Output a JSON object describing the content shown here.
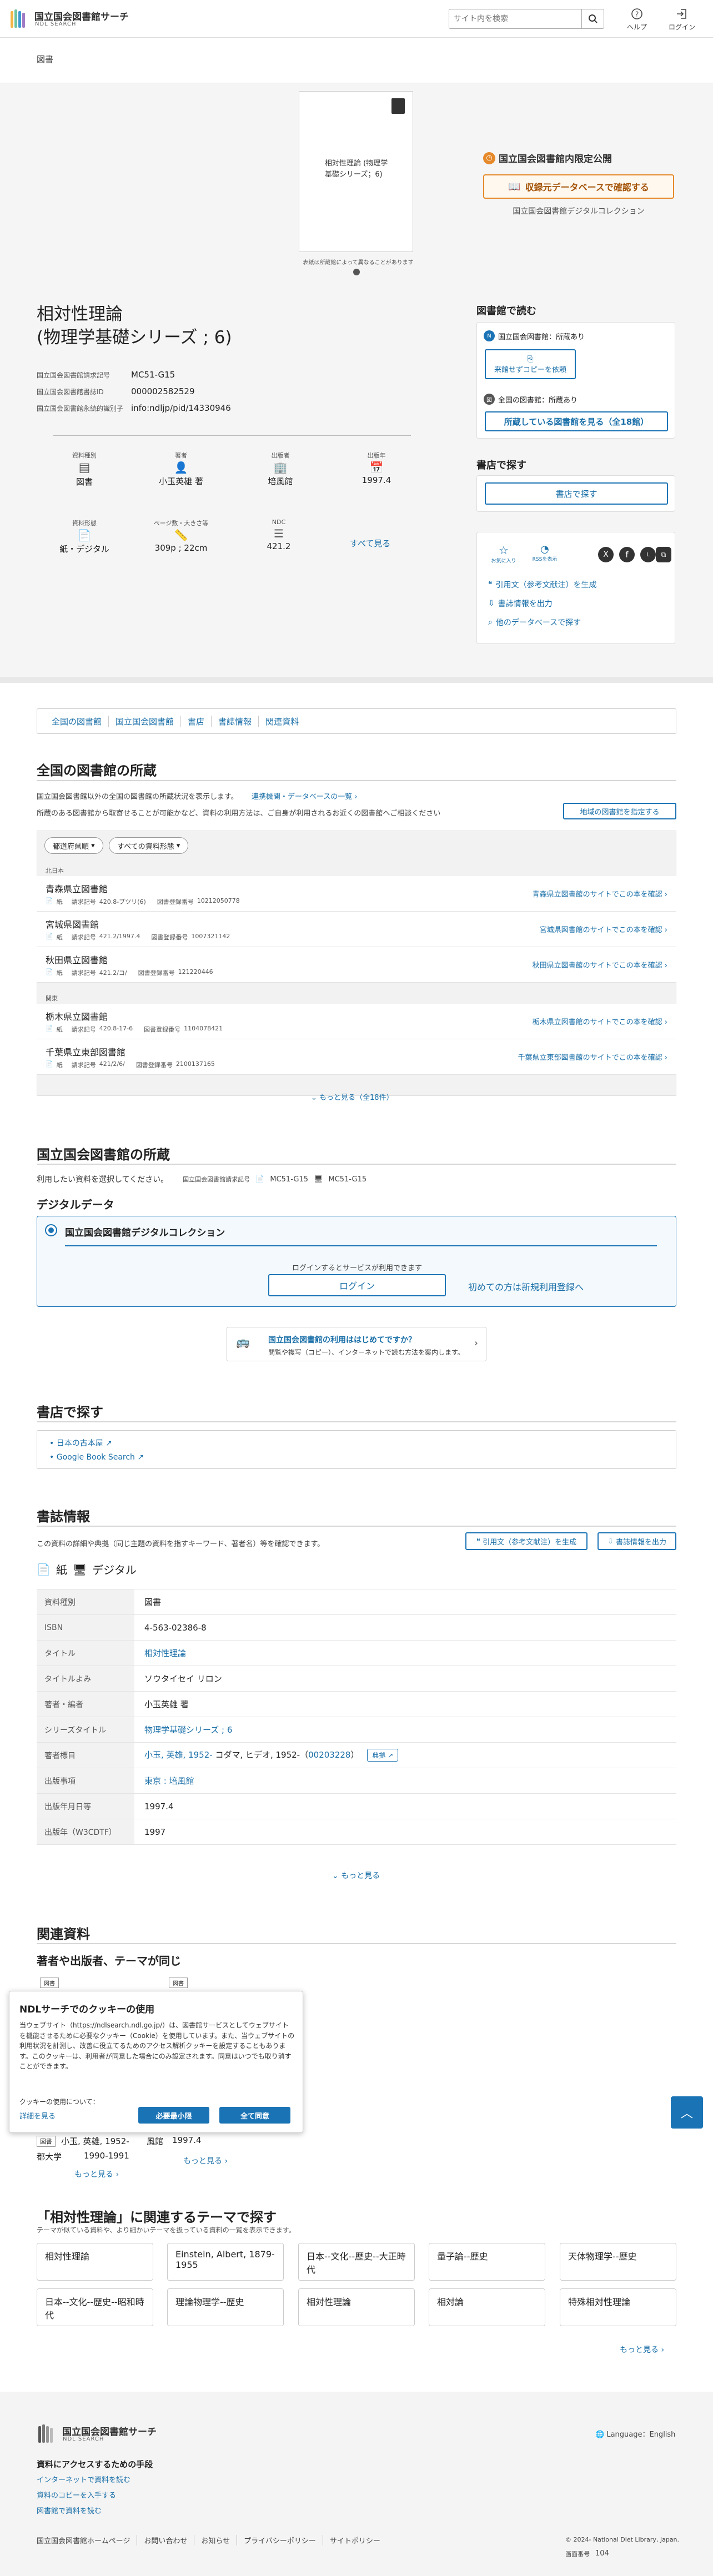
{
  "header": {
    "logo_jp": "国立国会図書館サーチ",
    "logo_en": "NDL SEARCH",
    "search_placeholder": "サイト内を検索",
    "help": "ヘルプ",
    "login": "ログイン"
  },
  "breadcrumb": "図書",
  "cover": {
    "title_text": "相対性理論 (物理学基礎シリーズ；6)",
    "note": "表紙は所蔵館によって異なることがあります"
  },
  "ndl_only": {
    "label": "国立国会図書館内限定公開",
    "button": "収録元データベースで確認する",
    "source": "国立国会図書館デジタルコレクション"
  },
  "book": {
    "title_line1": "相対性理論",
    "title_line2": "(物理学基礎シリーズ ; 6)",
    "meta": [
      {
        "key": "国立国会図書館請求記号",
        "value": "MC51-G15"
      },
      {
        "key": "国立国会図書館書誌ID",
        "value": "000002582529"
      },
      {
        "key": "国立国会図書館永続的識別子",
        "value": "info:ndljp/pid/14330946"
      }
    ],
    "facets_row1": [
      {
        "label": "資料種別",
        "value": "図書"
      },
      {
        "label": "著者",
        "value": "小玉英雄 著"
      },
      {
        "label": "出版者",
        "value": "培風館"
      },
      {
        "label": "出版年",
        "value": "1997.4"
      }
    ],
    "facets_row2": [
      {
        "label": "資料形態",
        "value": "紙・デジタル"
      },
      {
        "label": "ページ数・大きさ等",
        "value": "309p ; 22cm"
      },
      {
        "label": "NDC",
        "value": "421.2"
      }
    ],
    "see_all": "すべて見る"
  },
  "read_at_library": {
    "heading": "図書館で読む",
    "ndl_label": "国立国会図書館：所蔵あり",
    "copy_button": "来館せずコピーを依頼",
    "all_libs_label": "全国の図書館：所蔵あり",
    "all_libs_button": "所蔵している図書館を見る（全18館）"
  },
  "buy": {
    "heading": "書店で探す",
    "button": "書店で探す"
  },
  "share": {
    "favorite": "お気に入り",
    "rss": "RSSを表示",
    "cite": "引用文（参考文献注）を生成",
    "export": "書誌情報を出力",
    "other_db": "他のデータベースで探す"
  },
  "tabs": [
    "全国の図書館",
    "国立国会図書館",
    "書店",
    "書誌情報",
    "関連資料"
  ],
  "national_libraries": {
    "heading": "全国の図書館の所蔵",
    "desc1": "国立国会図書館以外の全国の図書館の所蔵状況を表示します。",
    "link": "連携機関・データベースの一覧",
    "desc2": "所蔵のある図書館から取寄せることが可能かなど、資料の利用方法は、ご自身が利用されるお近くの図書館へご相談ください",
    "region_button": "地域の図書館を指定する",
    "filter1": "都道府県順",
    "filter2": "すべての資料形態",
    "groups": [
      {
        "region": "北日本",
        "libs": [
          {
            "name": "青森県立図書館",
            "call": "420.8-ブツリ(6)",
            "reg": "10212050778",
            "link": "青森県立図書館のサイトでこの本を確認"
          },
          {
            "name": "宮城県図書館",
            "call": "421.2/1997.4",
            "reg": "1007321142",
            "link": "宮城県図書館のサイトでこの本を確認"
          },
          {
            "name": "秋田県立図書館",
            "call": "421.2/コ/",
            "reg": "121220446",
            "link": "秋田県立図書館のサイトでこの本を確認"
          }
        ]
      },
      {
        "region": "関東",
        "libs": [
          {
            "name": "栃木県立図書館",
            "call": "420.8-17-6",
            "reg": "1104078421",
            "link": "栃木県立図書館のサイトでこの本を確認"
          },
          {
            "name": "千葉県立東部図書館",
            "call": "421/2/6/",
            "reg": "2100137165",
            "link": "千葉県立東部図書館のサイトでこの本を確認"
          }
        ]
      }
    ],
    "paper": "紙",
    "call_label": "請求記号",
    "reg_label": "図書登録番号",
    "more": "もっと見る（全18件）"
  },
  "ndl_holdings": {
    "heading": "国立国会図書館の所蔵",
    "desc": "利用したい資料を選択してください。",
    "call_key": "国立国会図書館請求記号",
    "call1": "MC51-G15",
    "call2": "MC51-G15",
    "digital_heading": "デジタルデータ",
    "collection": "国立国会図書館デジタルコレクション",
    "login_note": "ログインするとサービスが利用できます",
    "login_button": "ログイン",
    "register": "初めての方は新規利用登録へ"
  },
  "first_time": {
    "title": "国立国会図書館の利用ははじめてですか？",
    "desc": "閲覧や複写（コピー）、インターネットで読む方法を案内します。"
  },
  "stores": {
    "heading": "書店で探す",
    "links": [
      "日本の古本屋",
      "Google Book Search"
    ]
  },
  "bib": {
    "heading": "書誌情報",
    "desc": "この資料の詳細や典拠（同じ主題の資料を指すキーワード、著者名）等を確認できます。",
    "cite_button": "引用文（参考文献注）を生成",
    "export_button": "書誌情報を出力",
    "formats": [
      "紙",
      "デジタル"
    ],
    "rows": [
      {
        "k": "資料種別",
        "v": "図書"
      },
      {
        "k": "ISBN",
        "v": "4-563-02386-8"
      },
      {
        "k": "タイトル",
        "v": "相対性理論"
      },
      {
        "k": "タイトルよみ",
        "v": "ソウタイセイ リロン"
      },
      {
        "k": "著者・編者",
        "v": "小玉英雄 著"
      },
      {
        "k": "シリーズタイトル",
        "v": "物理学基礎シリーズ ; 6"
      },
      {
        "k": "著者標目",
        "v_link": "小玉, 英雄, 1952-",
        "v_plain": " コダマ, ヒデオ, 1952-（",
        "v_id": "00203228",
        "v_end": "）",
        "tenkyo": "典拠"
      },
      {
        "k": "出版事項",
        "v": "東京 : 培風館"
      },
      {
        "k": "出版年月日等",
        "v": "1997.4"
      },
      {
        "k": "出版年（W3CDTF）",
        "v": "1997"
      }
    ],
    "more": "もっと見る"
  },
  "related": {
    "heading": "関連資料",
    "sub": "著者や出版者、テーマが同じ",
    "tag1": "図書",
    "tag2": "図書",
    "item_tag": "図書",
    "item_author": "小玉, 英雄, 1952-",
    "item_pub": "都大学",
    "item_years": "1990-1991",
    "item2_pub": "風館",
    "item2_year": "1997.4",
    "more1": "もっと見る",
    "more2": "もっと見る"
  },
  "cookie": {
    "title": "NDLサーチでのクッキーの使用",
    "body": "当ウェブサイト（https://ndlsearch.ndl.go.jp/）は、図書館サービスとしてウェブサイトを機能させるために必要なクッキー（Cookie）を使用しています。また、当ウェブサイトの利用状況を計測し、改善に役立てるためのアクセス解析クッキーを設定することもあります。このクッキーは、利用者が同意した場合にのみ設定されます。同意はいつでも取り消すことができます。",
    "about": "クッキーの使用について：",
    "details": "詳細を見る",
    "necessary": "必要最小限",
    "agree": "全て同意"
  },
  "themes": {
    "heading": "「相対性理論」に関連するテーマで探す",
    "desc": "テーマが似ている資料や、より細かいテーマを扱っている資料の一覧を表示できます。",
    "items": [
      "相対性理論",
      "Einstein, Albert, 1879-1955",
      "日本--文化--歴史--大正時代",
      "量子論--歴史",
      "天体物理学--歴史",
      "日本--文化--歴史--昭和時代",
      "理論物理学--歴史",
      "相対性理論",
      "相対論",
      "特殊相対性理論"
    ],
    "more": "もっと見る"
  },
  "footer": {
    "logo_jp": "国立国会図書館サーチ",
    "logo_en": "NDL SEARCH",
    "lang": "Language：English",
    "access_heading": "資料にアクセスするための手段",
    "access_links": [
      "インターネットで資料を読む",
      "資料のコピーを入手する",
      "図書館で資料を読む"
    ],
    "bottom_links": [
      "国立国会図書館ホームページ",
      "お問い合わせ",
      "お知らせ",
      "プライバシーポリシー",
      "サイトポリシー"
    ],
    "copyright": "© 2024- National Diet Library, Japan.",
    "page_no_label": "画面番号",
    "page_no": "104"
  },
  "colors": {
    "accent": "#1a73b5",
    "orange": "#e5892a",
    "bg_gray": "#f5f5f5"
  }
}
